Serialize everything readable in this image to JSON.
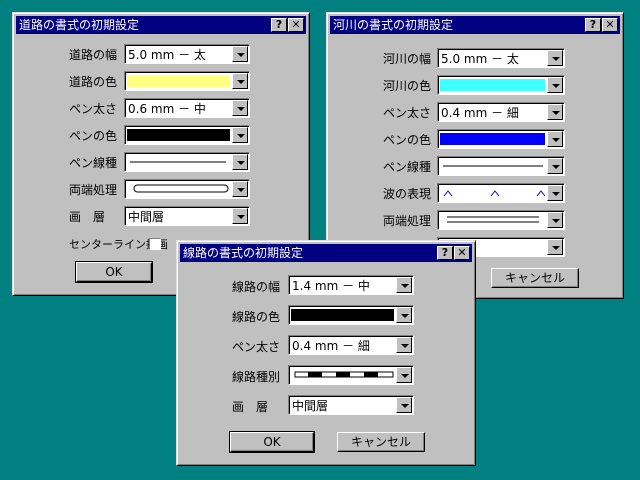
{
  "road": {
    "title": "道路の書式の初期設定",
    "help": "?",
    "close": "✕",
    "width_label": "道路の幅",
    "width_value": "5.0 mm － 太",
    "color_label": "道路の色",
    "color_value": "#ffff80",
    "pen_width_label": "ペン太さ",
    "pen_width_value": "0.6 mm － 中",
    "pen_color_label": "ペンの色",
    "pen_color_value": "#000000",
    "pen_line_label": "ペン線種",
    "ends_label": "両端処理",
    "layer_label": "画　層",
    "layer_value": "中間層",
    "centerline_label": "センターライン描画",
    "ok": "OK"
  },
  "river": {
    "title": "河川の書式の初期設定",
    "help": "?",
    "close": "✕",
    "width_label": "河川の幅",
    "width_value": "5.0 mm － 太",
    "color_label": "河川の色",
    "color_value": "#40ffff",
    "pen_width_label": "ペン太さ",
    "pen_width_value": "0.4 mm － 細",
    "pen_color_label": "ペンの色",
    "pen_color_value": "#0000ff",
    "pen_line_label": "ペン線種",
    "wave_label": "波の表現",
    "ends_label": "両端処理",
    "cancel": "キャンセル"
  },
  "rail": {
    "title": "線路の書式の初期設定",
    "help": "?",
    "close": "✕",
    "width_label": "線路の幅",
    "width_value": "1.4 mm － 中",
    "color_label": "線路の色",
    "color_value": "#000000",
    "pen_width_label": "ペン太さ",
    "pen_width_value": "0.4 mm － 細",
    "type_label": "線路種別",
    "layer_label": "画　層",
    "layer_value": "中間層",
    "ok": "OK",
    "cancel": "キャンセル"
  }
}
